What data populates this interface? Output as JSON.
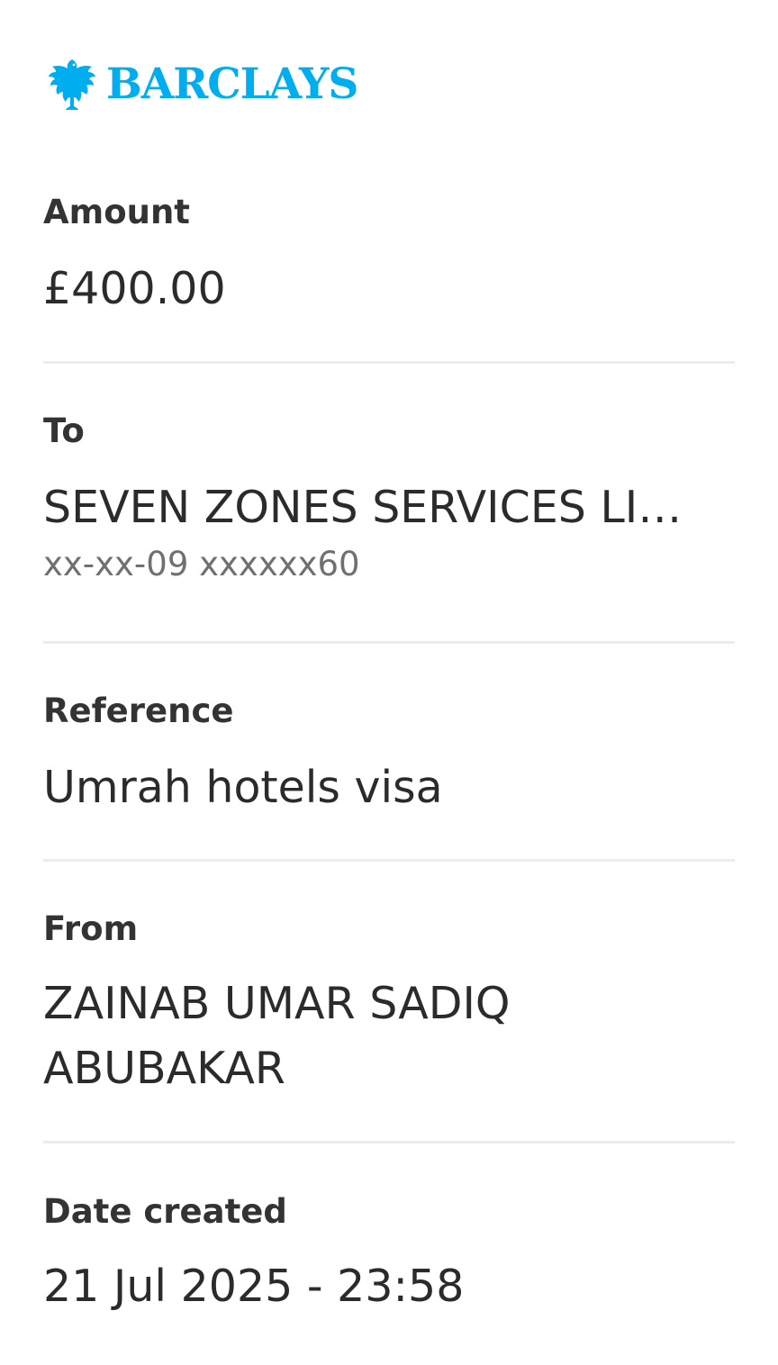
{
  "brand": {
    "name": "BARCLAYS",
    "color": "#00AEEF",
    "icon": "eagle-icon"
  },
  "amount": {
    "label": "Amount",
    "value": "£400.00"
  },
  "to": {
    "label": "To",
    "name": "SEVEN ZONES SERVICES LIMI…",
    "account": "xx-xx-09 xxxxxx60"
  },
  "reference": {
    "label": "Reference",
    "value": "Umrah hotels visa"
  },
  "from": {
    "label": "From",
    "value": "ZAINAB UMAR SADIQ ABUBAKAR"
  },
  "date_created": {
    "label": "Date created",
    "value": "21 Jul 2025 - 23:58"
  }
}
